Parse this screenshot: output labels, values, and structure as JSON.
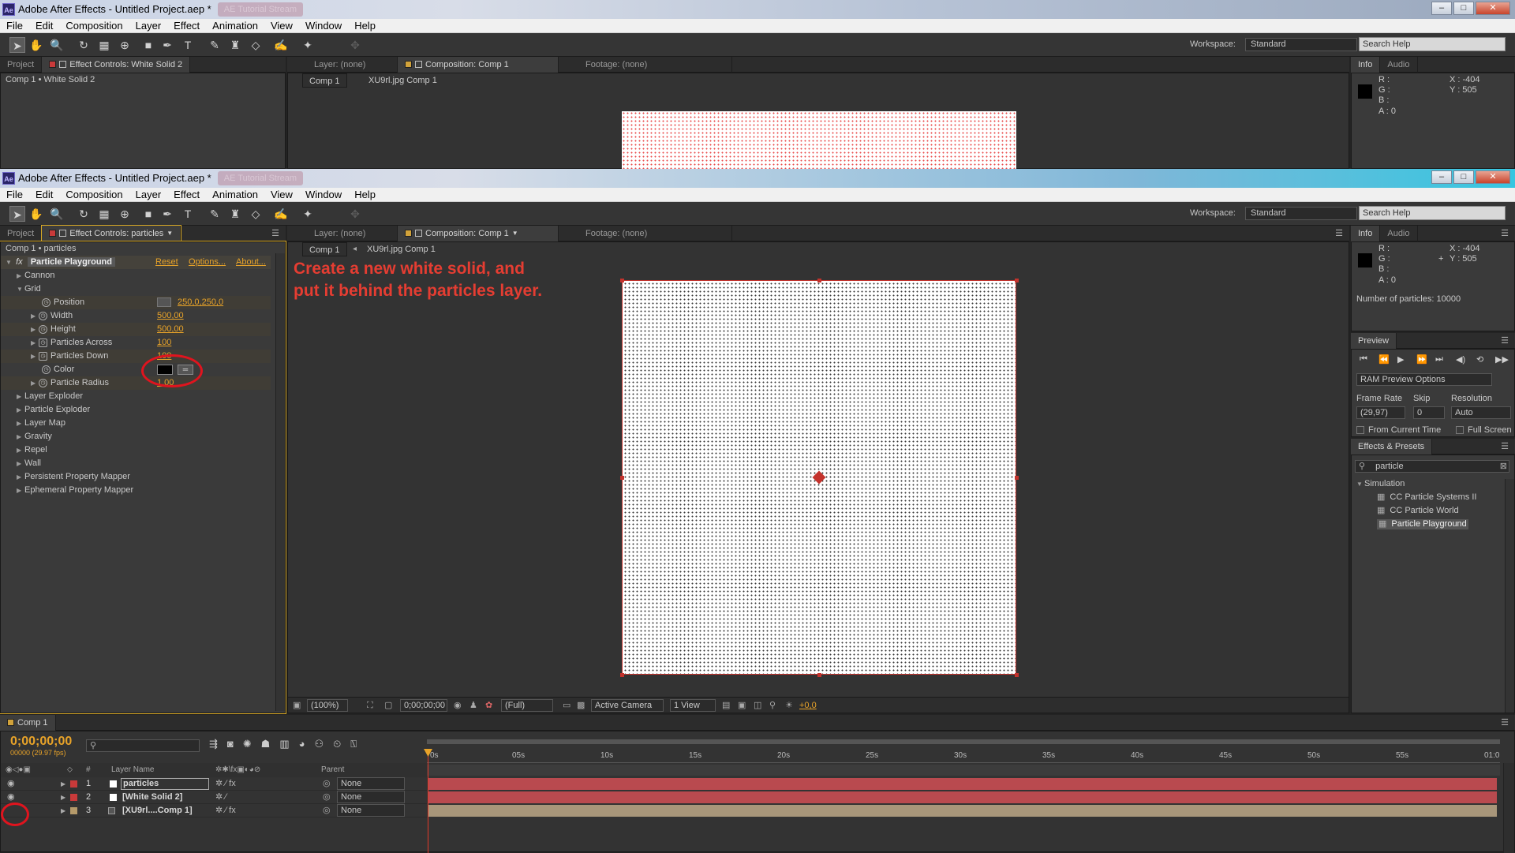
{
  "back_window": {
    "title": "Adobe After Effects - Untitled Project.aep *",
    "menu": [
      "File",
      "Edit",
      "Composition",
      "Layer",
      "Effect",
      "Animation",
      "View",
      "Window",
      "Help"
    ],
    "workspace_label": "Workspace:",
    "workspace_value": "Standard",
    "search_help": "Search Help",
    "left_tabs": [
      "Project",
      "Effect Controls: White Solid 2"
    ],
    "breadcrumb": "Comp 1 • White Solid 2",
    "viewer_tabs": [
      "Layer: (none)",
      "Composition: Comp 1",
      "Footage: (none)"
    ],
    "comp_tab": "Comp 1",
    "comp_crumb": "XU9rl.jpg Comp 1",
    "right_tabs": [
      "Info",
      "Audio"
    ],
    "info": {
      "r": "R :",
      "g": "G :",
      "b": "B :",
      "a": "A : 0",
      "x": "X : -404",
      "y": "Y : 505"
    }
  },
  "window": {
    "title": "Adobe After Effects - Untitled Project.aep *",
    "ghost_tab": "AE Tutorial Stream",
    "menu": [
      "File",
      "Edit",
      "Composition",
      "Layer",
      "Effect",
      "Animation",
      "View",
      "Window",
      "Help"
    ],
    "workspace_label": "Workspace:",
    "workspace_value": "Standard",
    "search_help": "Search Help"
  },
  "effect_controls": {
    "tabs": [
      "Project",
      "Effect Controls: particles"
    ],
    "breadcrumb": "Comp 1 • particles",
    "effect_name": "Particle Playground",
    "fx": "fx",
    "reset": "Reset",
    "options": "Options...",
    "about": "About...",
    "groups": [
      {
        "label": "Cannon",
        "level": 1
      },
      {
        "label": "Grid",
        "level": 1,
        "open": true
      }
    ],
    "grid_props": [
      {
        "label": "Position",
        "value": "250,0,250,0"
      },
      {
        "label": "Width",
        "value": "500,00"
      },
      {
        "label": "Height",
        "value": "500,00"
      },
      {
        "label": "Particles Across",
        "value": "100"
      },
      {
        "label": "Particles Down",
        "value": "100"
      },
      {
        "label": "Color",
        "value": ""
      },
      {
        "label": "Particle Radius",
        "value": "1,00"
      }
    ],
    "more_groups": [
      "Layer Exploder",
      "Particle Exploder",
      "Layer Map",
      "Gravity",
      "Repel",
      "Wall",
      "Persistent Property Mapper",
      "Ephemeral Property Mapper"
    ]
  },
  "viewer": {
    "tabs": [
      "Layer: (none)",
      "Composition: Comp 1",
      "Footage: (none)"
    ],
    "comp_tab": "Comp 1",
    "comp_crumb": "XU9rl.jpg Comp 1",
    "annotation_line1": "Create a new white solid, and",
    "annotation_line2": "put it behind the particles layer.",
    "bottom": {
      "zoom": "(100%)",
      "timecode": "0;00;00;00",
      "quality": "(Full)",
      "camera": "Active Camera",
      "view": "1 View",
      "exposure": "+0,0"
    }
  },
  "info_panel": {
    "tabs": [
      "Info",
      "Audio"
    ],
    "r": "R :",
    "g": "G :",
    "b": "B :",
    "a": "A : 0",
    "x": "X : -404",
    "y": "Y : 505",
    "particles": "Number of particles: 10000"
  },
  "preview_panel": {
    "tab": "Preview",
    "ram": "RAM Preview Options",
    "frame_rate_label": "Frame Rate",
    "frame_rate": "(29,97)",
    "skip_label": "Skip",
    "skip": "0",
    "resolution_label": "Resolution",
    "resolution": "Auto",
    "from_current": "From Current Time",
    "full_screen": "Full Screen"
  },
  "effects_presets": {
    "tab": "Effects & Presets",
    "search": "particle",
    "category": "Simulation",
    "items": [
      "CC Particle Systems II",
      "CC Particle World",
      "Particle Playground"
    ]
  },
  "timeline": {
    "tab": "Comp 1",
    "timecode": "0;00;00;00",
    "frames": "00000 (29.97 fps)",
    "col_num": "#",
    "col_layer": "Layer Name",
    "col_parent": "Parent",
    "ruler": [
      "0s",
      "05s",
      "10s",
      "15s",
      "20s",
      "25s",
      "30s",
      "35s",
      "40s",
      "45s",
      "50s",
      "55s",
      "01:0"
    ],
    "layers": [
      {
        "num": "1",
        "name": "particles",
        "parent": "None",
        "color": "#c93a3a"
      },
      {
        "num": "2",
        "name": "[White Solid 2]",
        "parent": "None",
        "color": "#c93a3a"
      },
      {
        "num": "3",
        "name": "[XU9rl....Comp 1]",
        "parent": "None",
        "color": "#b59a6a"
      }
    ]
  },
  "colors": {
    "accent": "#e8a329",
    "annotation": "#e53d32",
    "bar_red": "#b94a4f",
    "bar_tan": "#a8967a"
  }
}
